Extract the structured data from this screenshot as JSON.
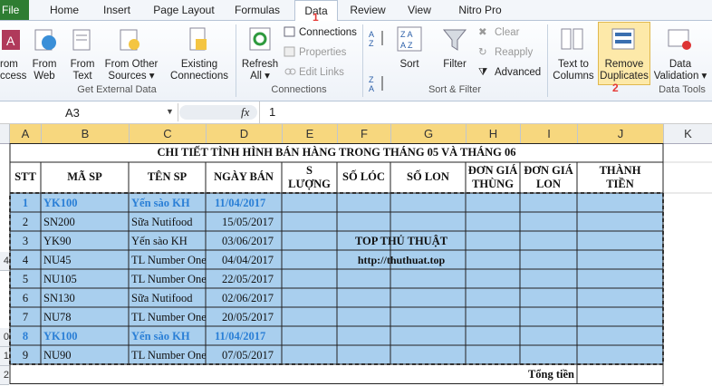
{
  "tabs": [
    "File",
    "Home",
    "Insert",
    "Page Layout",
    "Formulas",
    "Data",
    "Review",
    "View",
    "Nitro Pro"
  ],
  "annotations": {
    "one": "1",
    "two": "2"
  },
  "ribbon": {
    "ext": {
      "from_access": "rom\nccess",
      "from_web": "From\nWeb",
      "from_text": "From\nText",
      "from_other": "From Other\nSources ▾",
      "existing": "Existing\nConnections",
      "label": "Get External Data"
    },
    "conn": {
      "refresh": "Refresh\nAll ▾",
      "connections": "Connections",
      "properties": "Properties",
      "edit_links": "Edit Links",
      "label": "Connections"
    },
    "sort": {
      "sort": "Sort",
      "filter": "Filter",
      "clear": "Clear",
      "reapply": "Reapply",
      "advanced": "Advanced",
      "label": "Sort & Filter"
    },
    "tools": {
      "text_to_columns": "Text to\nColumns",
      "remove_duplicates": "Remove\nDuplicates",
      "data_validation": "Data\nValidation ▾",
      "label": "Data Tools"
    }
  },
  "formula_bar": {
    "name_box": "A3",
    "fx": "fx",
    "value": "1"
  },
  "columns": [
    "A",
    "B",
    "C",
    "D",
    "E",
    "F",
    "G",
    "H",
    "I",
    "J",
    "K"
  ],
  "sheet": {
    "title": "CHI TIẾT TÌNH HÌNH BÁN HÀNG TRONG THÁNG 05 VÀ THÁNG 06",
    "headers": [
      "STT",
      "MÃ SP",
      "TÊN SP",
      "NGÀY BÁN",
      "S\nLƯỢNG",
      "SỐ LÓC",
      "SỐ LON",
      "ĐƠN GIÁ\nTHÙNG",
      "ĐƠN GIÁ\nLON",
      "THÀNH\nTIỀN"
    ],
    "rows": [
      [
        "1",
        "YK100",
        "Yến sào KH",
        "11/04/2017"
      ],
      [
        "2",
        "SN200",
        "Sữa Nutifood",
        "15/05/2017"
      ],
      [
        "3",
        "YK90",
        "Yến sào KH",
        "03/06/2017"
      ],
      [
        "4",
        "NU45",
        "TL Number One",
        "04/04/2017"
      ],
      [
        "5",
        "NU105",
        "TL Number One",
        "22/05/2017"
      ],
      [
        "6",
        "SN130",
        "Sữa Nutifood",
        "02/06/2017"
      ],
      [
        "7",
        "NU78",
        "TL Number One",
        "20/05/2017"
      ],
      [
        "8",
        "YK100",
        "Yến sào KH",
        "11/04/2017"
      ],
      [
        "9",
        "NU90",
        "TL Number One",
        "07/05/2017"
      ]
    ],
    "row_numbers": [
      "4",
      "0",
      "1",
      "2"
    ],
    "watermark1": "TOP THỦ THUẬT",
    "watermark2": "http://thuthuat.top",
    "total_label": "Tổng tiền"
  }
}
